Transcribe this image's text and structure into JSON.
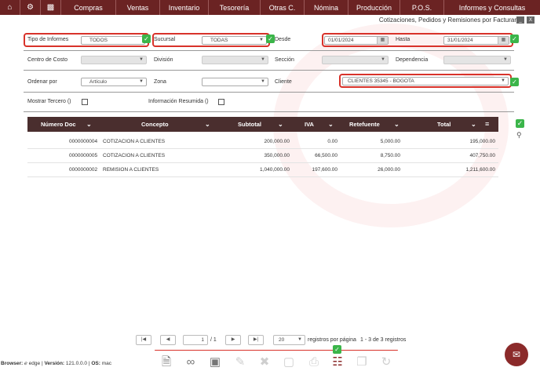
{
  "nav": {
    "home_icon": "home-icon",
    "settings_icon": "gear-icon",
    "chart_icon": "bar-chart-icon",
    "items": [
      "Compras",
      "Ventas",
      "Inventario",
      "Tesorería",
      "Otras C.",
      "Nómina",
      "Producción",
      "P.O.S.",
      "Informes y Consultas"
    ]
  },
  "page": {
    "title": "Cotizaciones, Pedidos y Remisiones por Facturar",
    "minimize": "_",
    "close": "X"
  },
  "form": {
    "tipo_informes_label": "Tipo de Informes",
    "tipo_informes_value": "TODOS",
    "sucursal_label": "Sucursal",
    "sucursal_value": "TODAS",
    "desde_label": "Desde",
    "desde_value": "01/01/2024",
    "hasta_label": "Hasta",
    "hasta_value": "31/01/2024",
    "centro_costo_label": "Centro de Costo",
    "division_label": "División",
    "seccion_label": "Sección",
    "dependencia_label": "Dependencia",
    "ordenar_label": "Ordenar por",
    "ordenar_value": "Artículo",
    "zona_label": "Zona",
    "cliente_label": "Cliente",
    "cliente_value": "CLIENTES 35345 - BOGOTA",
    "mostrar_tercero_label": "Mostrar Tercero ()",
    "info_resumida_label": "Información Resumida ()"
  },
  "grid": {
    "columns": [
      "Número Doc",
      "Concepto",
      "Subtotal",
      "IVA",
      "Retefuente",
      "Total"
    ],
    "rows": [
      {
        "doc": "0000000004",
        "concepto": "COTIZACION A CLIENTES",
        "subtotal": "200,000.00",
        "iva": "0.00",
        "retefuente": "5,000.00",
        "total": "195,000.00"
      },
      {
        "doc": "0000000005",
        "concepto": "COTIZACION A CLIENTES",
        "subtotal": "350,000.00",
        "iva": "66,500.00",
        "retefuente": "8,750.00",
        "total": "407,750.00"
      },
      {
        "doc": "0000000002",
        "concepto": "REMISION A CLIENTES",
        "subtotal": "1,040,000.00",
        "iva": "197,600.00",
        "retefuente": "26,000.00",
        "total": "1,211,600.00"
      }
    ]
  },
  "pager": {
    "first": "|◀",
    "prev": "◀",
    "page": "1",
    "of": "/ 1",
    "next": "▶",
    "last": "▶|",
    "per_page": "20",
    "per_page_label": "registros por página",
    "range": "1 - 3 de 3 registros"
  },
  "footer": {
    "info_browser_label": "Browser:",
    "info_browser_value": "edge",
    "info_version_label": "Versión:",
    "info_version_value": "121.0.0.0",
    "info_os_label": "OS:",
    "info_os_value": "mac"
  },
  "colors": {
    "brand": "#6b2323",
    "grid_header": "#4a2e2e",
    "highlight": "#d8322a",
    "check": "#3bb54a"
  }
}
